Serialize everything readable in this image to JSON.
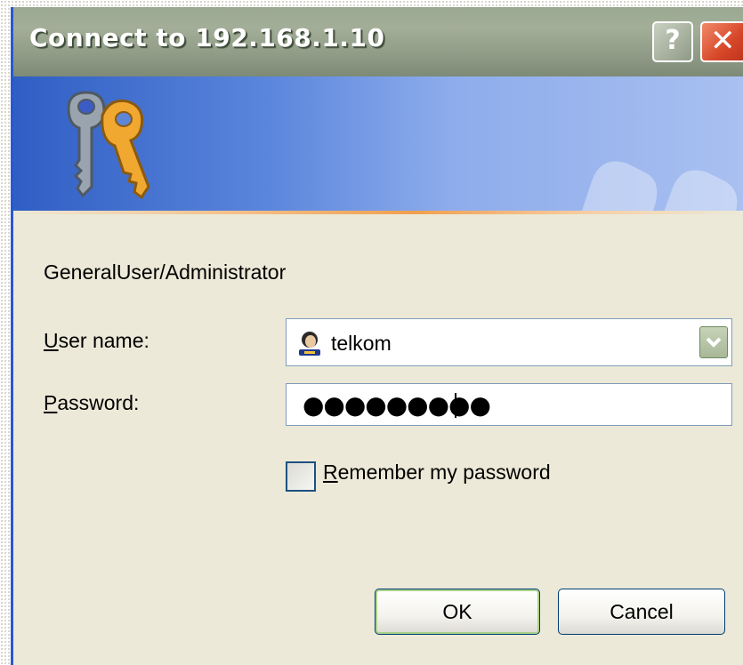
{
  "dialog": {
    "title": "Connect to 192.168.1.10",
    "help_glyph": "?",
    "close_glyph": "✕",
    "realm": "GeneralUser/Administrator",
    "username_label_underlined": "U",
    "username_label_rest": "ser name:",
    "username_value": "telkom",
    "password_label_underlined": "P",
    "password_label_rest": "assword:",
    "password_mask": "●●●●●●●●●",
    "remember_underlined": "R",
    "remember_rest": "emember my password",
    "remember_checked": false,
    "ok_label": "OK",
    "cancel_label": "Cancel"
  },
  "icons": {
    "banner": "keys-icon",
    "user": "user-icon",
    "dropdown": "chevron-down-icon"
  },
  "colors": {
    "title_bar": "#9aa892",
    "banner_blue": "#2f5ec4",
    "dialog_bg": "#ece9d8",
    "close_red": "#d8482a"
  }
}
